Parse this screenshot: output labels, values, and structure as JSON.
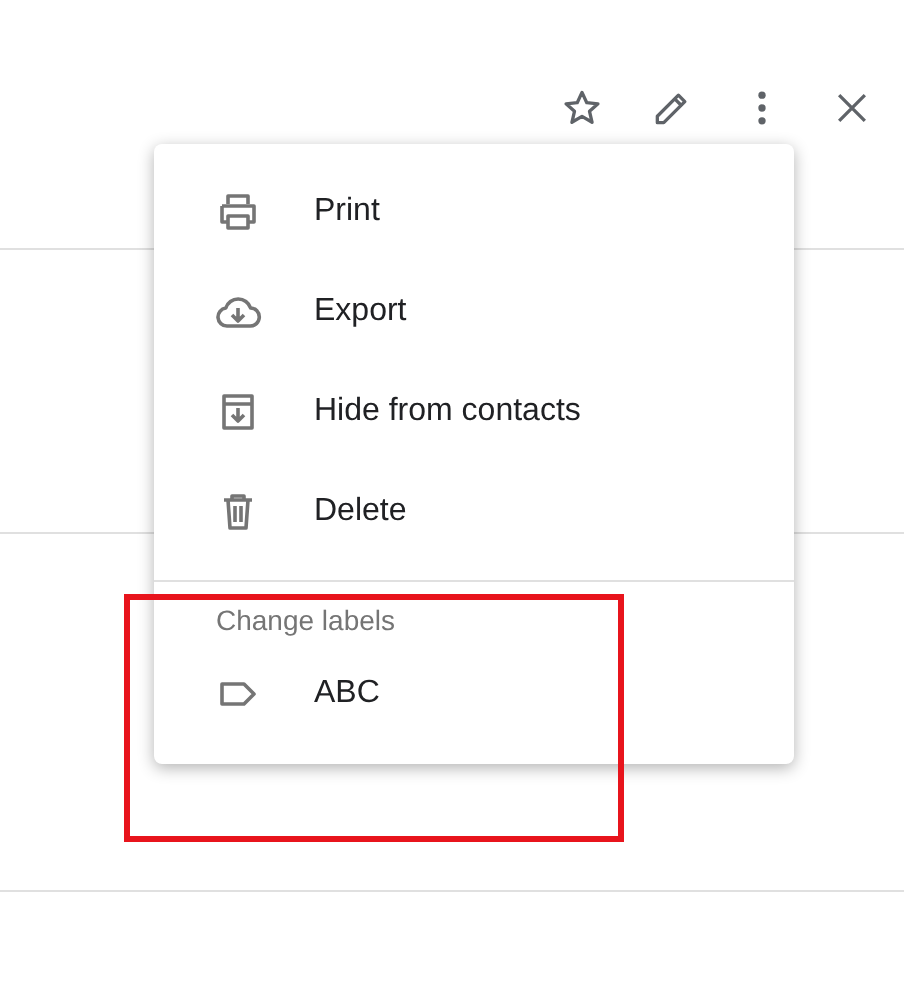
{
  "menu": {
    "items": [
      {
        "kind": "print",
        "label": "Print"
      },
      {
        "kind": "export",
        "label": "Export"
      },
      {
        "kind": "hide",
        "label": "Hide from contacts"
      },
      {
        "kind": "delete",
        "label": "Delete"
      }
    ],
    "section_title": "Change labels",
    "labels": [
      {
        "label": "ABC"
      }
    ]
  }
}
